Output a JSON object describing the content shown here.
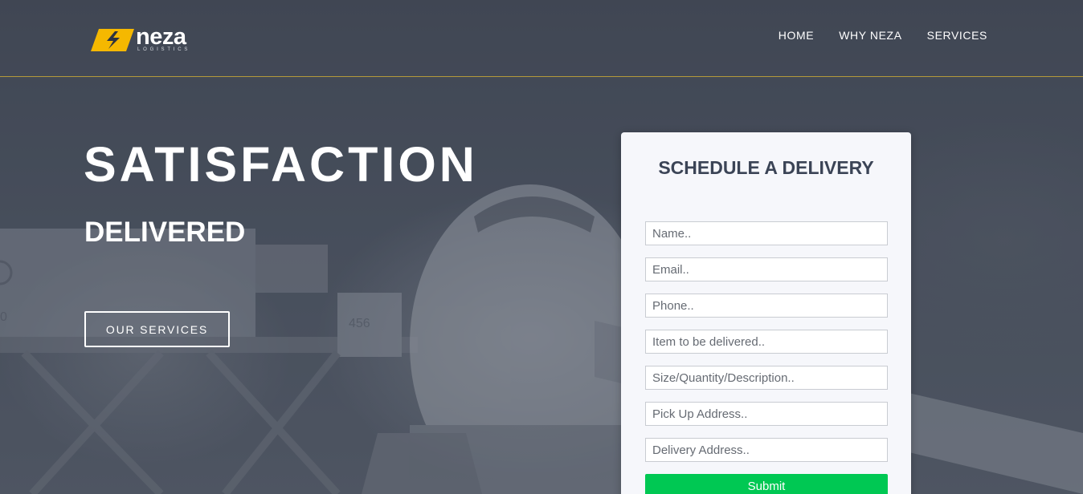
{
  "brand": {
    "name": "neza",
    "tagline": "LOGISTICS",
    "accent_color": "#f5b800"
  },
  "nav": {
    "items": [
      {
        "label": "HOME"
      },
      {
        "label": "WHY NEZA"
      },
      {
        "label": "SERVICES"
      }
    ]
  },
  "hero": {
    "title": "SATISFACTION",
    "subtitle": "DELIVERED",
    "cta_label": "OUR SERVICES"
  },
  "form": {
    "title": "SCHEDULE A DELIVERY",
    "fields": [
      {
        "placeholder": "Name.."
      },
      {
        "placeholder": "Email.."
      },
      {
        "placeholder": "Phone.."
      },
      {
        "placeholder": "Item to be delivered.."
      },
      {
        "placeholder": "Size/Quantity/Description.."
      },
      {
        "placeholder": "Pick Up Address.."
      },
      {
        "placeholder": "Delivery Address.."
      }
    ],
    "submit_label": "Submit",
    "submit_color": "#00c853"
  },
  "scene": {
    "truck_number": "456",
    "truck_side_number": "0"
  }
}
